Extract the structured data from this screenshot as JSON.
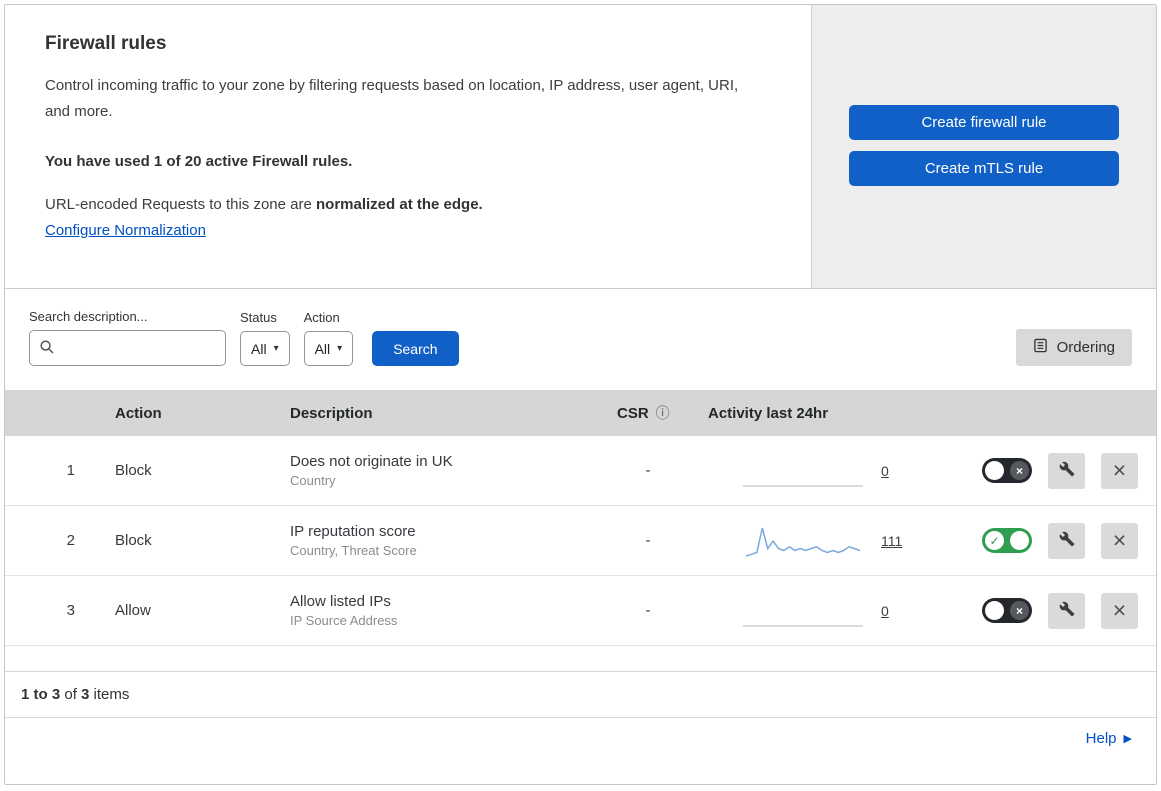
{
  "colors": {
    "accent_blue": "#1160c7",
    "toggle_green": "#2f9e50",
    "link_blue": "#0051c3",
    "sparkline_blue": "#78a9dd",
    "sparkline_flat": "#cfcfcf"
  },
  "icons": {
    "info": "ⓘ",
    "caret": "▾",
    "close": "×",
    "help_arrow": "▶"
  },
  "header": {
    "title": "Firewall rules",
    "description": "Control incoming traffic to your zone by filtering requests based on location, IP address, user agent, URI, and more.",
    "usage": "You have used 1 of 20 active Firewall rules.",
    "normalization_text": "URL-encoded Requests to this zone are ",
    "normalization_bold": "normalized at the edge.",
    "normalization_link": "Configure Normalization",
    "create_firewall_button": "Create firewall rule",
    "create_mtls_button": "Create mTLS rule"
  },
  "filters": {
    "search_label": "Search description...",
    "status_label": "Status",
    "status_value": "All",
    "action_label": "Action",
    "action_value": "All",
    "search_button": "Search",
    "ordering_button": "Ordering"
  },
  "table": {
    "headers": {
      "action": "Action",
      "description": "Description",
      "csr": "CSR",
      "activity": "Activity last 24hr"
    },
    "rows": [
      {
        "index": "1",
        "action": "Block",
        "description": "Does not originate in UK",
        "criteria": "Country",
        "csr": "-",
        "activity_count": "0",
        "enabled": false,
        "sparkline": []
      },
      {
        "index": "2",
        "action": "Block",
        "description": "IP reputation score",
        "criteria": "Country, Threat Score",
        "csr": "-",
        "activity_count": "111",
        "enabled": true,
        "sparkline": [
          1,
          2,
          3,
          16,
          5,
          9,
          5,
          4,
          6,
          4,
          5,
          4,
          5,
          6,
          4,
          3,
          4,
          3,
          4,
          6,
          5,
          4
        ]
      },
      {
        "index": "3",
        "action": "Allow",
        "description": "Allow listed IPs",
        "criteria": "IP Source Address",
        "csr": "-",
        "activity_count": "0",
        "enabled": false,
        "sparkline": []
      }
    ]
  },
  "footer": {
    "range": "1 to 3",
    "of": " of ",
    "total": "3",
    "items": " items",
    "help": "Help"
  }
}
